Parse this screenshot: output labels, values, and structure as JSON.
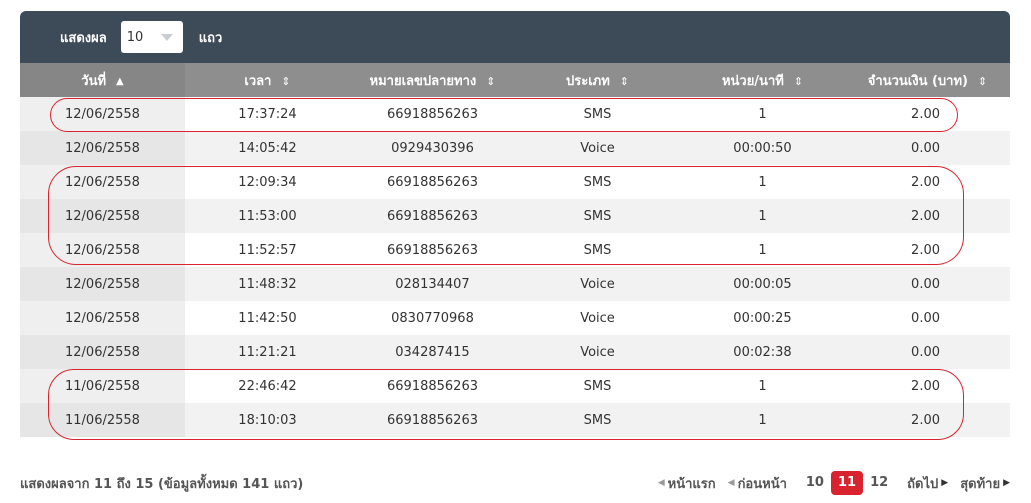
{
  "length_control": {
    "show_label": "แสดงผล",
    "value": "10",
    "rows_label": "แถว"
  },
  "columns": [
    {
      "label": "วันที่",
      "sort": "asc"
    },
    {
      "label": "เวลา",
      "sort": "both"
    },
    {
      "label": "หมายเลขปลายทาง",
      "sort": "both"
    },
    {
      "label": "ประเภท",
      "sort": "both"
    },
    {
      "label": "หน่วย/นาที",
      "sort": "both"
    },
    {
      "label": "จำนวนเงิน (บาท)",
      "sort": "both"
    }
  ],
  "sort_icons": {
    "asc": "▲",
    "both": "⇕"
  },
  "rows": [
    [
      "12/06/2558",
      "17:37:24",
      "66918856263",
      "SMS",
      "1",
      "2.00"
    ],
    [
      "12/06/2558",
      "14:05:42",
      "0929430396",
      "Voice",
      "00:00:50",
      "0.00"
    ],
    [
      "12/06/2558",
      "12:09:34",
      "66918856263",
      "SMS",
      "1",
      "2.00"
    ],
    [
      "12/06/2558",
      "11:53:00",
      "66918856263",
      "SMS",
      "1",
      "2.00"
    ],
    [
      "12/06/2558",
      "11:52:57",
      "66918856263",
      "SMS",
      "1",
      "2.00"
    ],
    [
      "12/06/2558",
      "11:48:32",
      "028134407",
      "Voice",
      "00:00:05",
      "0.00"
    ],
    [
      "12/06/2558",
      "11:42:50",
      "0830770968",
      "Voice",
      "00:00:25",
      "0.00"
    ],
    [
      "12/06/2558",
      "11:21:21",
      "034287415",
      "Voice",
      "00:02:38",
      "0.00"
    ],
    [
      "11/06/2558",
      "22:46:42",
      "66918856263",
      "SMS",
      "1",
      "2.00"
    ],
    [
      "11/06/2558",
      "18:10:03",
      "66918856263",
      "SMS",
      "1",
      "2.00"
    ]
  ],
  "highlight_color": "#d9232e",
  "footer": {
    "info": "แสดงผลจาก 11 ถึง 15 (ข้อมูลทั้งหมด 141 แถว)"
  },
  "pagination": {
    "first": "หน้าแรก",
    "previous": "ก่อนหน้า",
    "pages": [
      "10",
      "11",
      "12"
    ],
    "current": "11",
    "next": "ถัดไป",
    "last": "สุดท้าย"
  }
}
